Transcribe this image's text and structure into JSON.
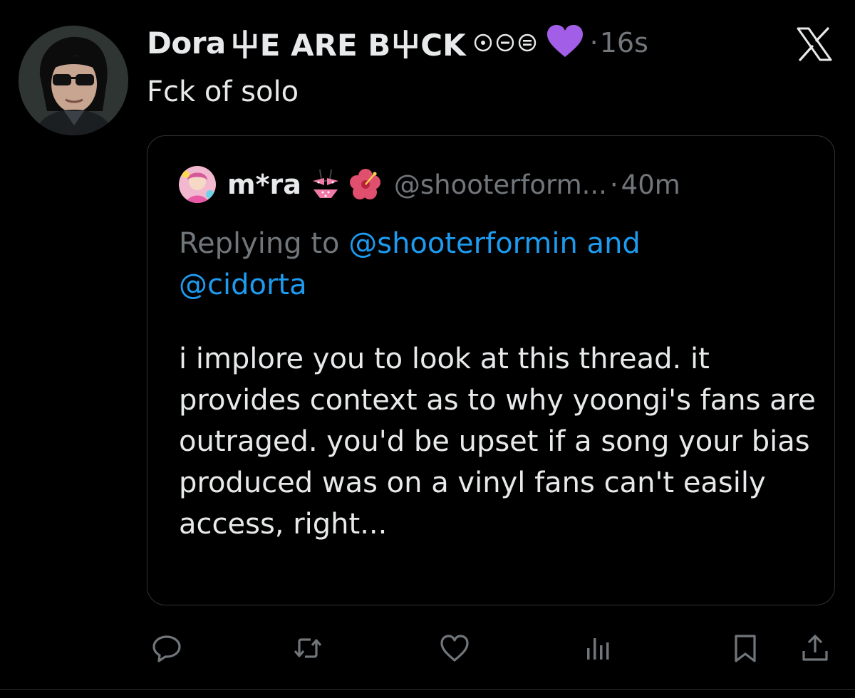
{
  "tweet": {
    "author_name": "Dora",
    "author_name_suffix": "⼬E ARE B⼬CK",
    "name_icons": [
      "circle-dot-icon",
      "circle-minus-icon",
      "circle-equals-icon"
    ],
    "name_emoji": "purple-heart-icon",
    "dot": "·",
    "time": "16s",
    "text": "Fck of solo"
  },
  "quote": {
    "author_name": "m*ra",
    "name_emojis": [
      "bikini-icon",
      "hibiscus-icon"
    ],
    "handle": "@shooterform...",
    "dot": "·",
    "time": "40m",
    "replying_prefix": "Replying to ",
    "mention_1": "@shooterformin",
    "and": " and",
    "mention_2": "@cidorta",
    "body": "i implore you to look at this thread. it provides context as to why yoongi's fans are outraged. you'd be upset if a song your bias produced was on a vinyl fans can't easily access, right..."
  },
  "actions": [
    "reply-icon",
    "retweet-icon",
    "like-icon",
    "views-icon",
    "bookmark-icon",
    "share-icon"
  ],
  "colors": {
    "background": "#000000",
    "text": "#e7e9ea",
    "muted": "#71767b",
    "link": "#1d9bf0",
    "border": "#2f3336",
    "heart": "#a25ee6"
  }
}
